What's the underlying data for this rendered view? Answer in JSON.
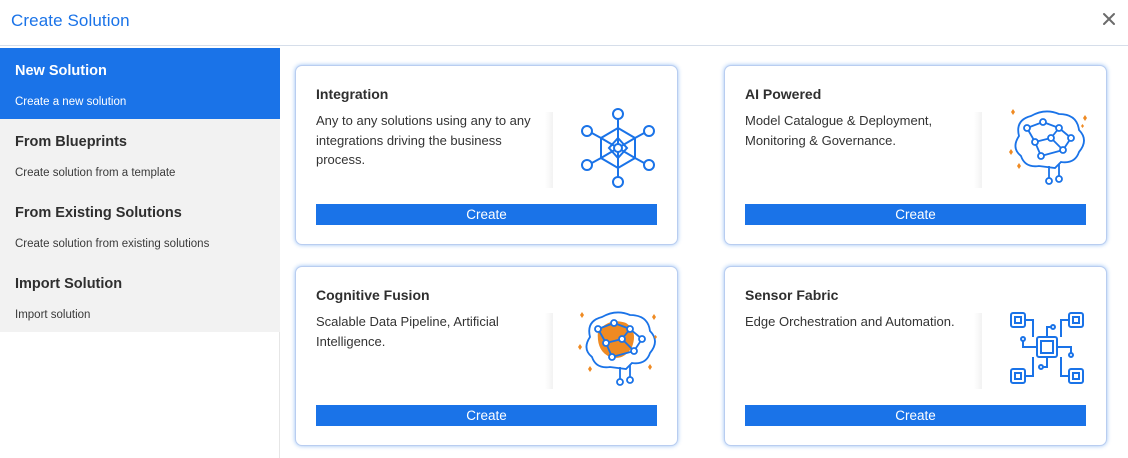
{
  "window": {
    "title": "Create Solution",
    "close_icon": "close-icon"
  },
  "sidebar": {
    "items": [
      {
        "title": "New Solution",
        "subtitle": "Create a new solution",
        "active": true
      },
      {
        "title": "From Blueprints",
        "subtitle": "Create solution from a template",
        "active": false
      },
      {
        "title": "From Existing Solutions",
        "subtitle": "Create solution from existing solutions",
        "active": false
      },
      {
        "title": "Import Solution",
        "subtitle": "Import solution",
        "active": false
      }
    ]
  },
  "cards": [
    {
      "title": "Integration",
      "description": "Any to any solutions using any to any integrations driving the business process.",
      "button": "Create",
      "icon": "integration-network-icon"
    },
    {
      "title": "AI Powered",
      "description": "Model Catalogue & Deployment, Monitoring & Governance.",
      "button": "Create",
      "icon": "ai-brain-icon"
    },
    {
      "title": "Cognitive Fusion",
      "description": "Scalable Data Pipeline, Artificial Intelligence.",
      "button": "Create",
      "icon": "cognitive-brain-icon"
    },
    {
      "title": "Sensor Fabric",
      "description": "Edge Orchestration and Automation.",
      "button": "Create",
      "icon": "sensor-chip-icon"
    }
  ],
  "colors": {
    "accent": "#1a73e8",
    "sidebar_bg": "#f2f2f2",
    "icon_orange": "#ef8a22"
  }
}
